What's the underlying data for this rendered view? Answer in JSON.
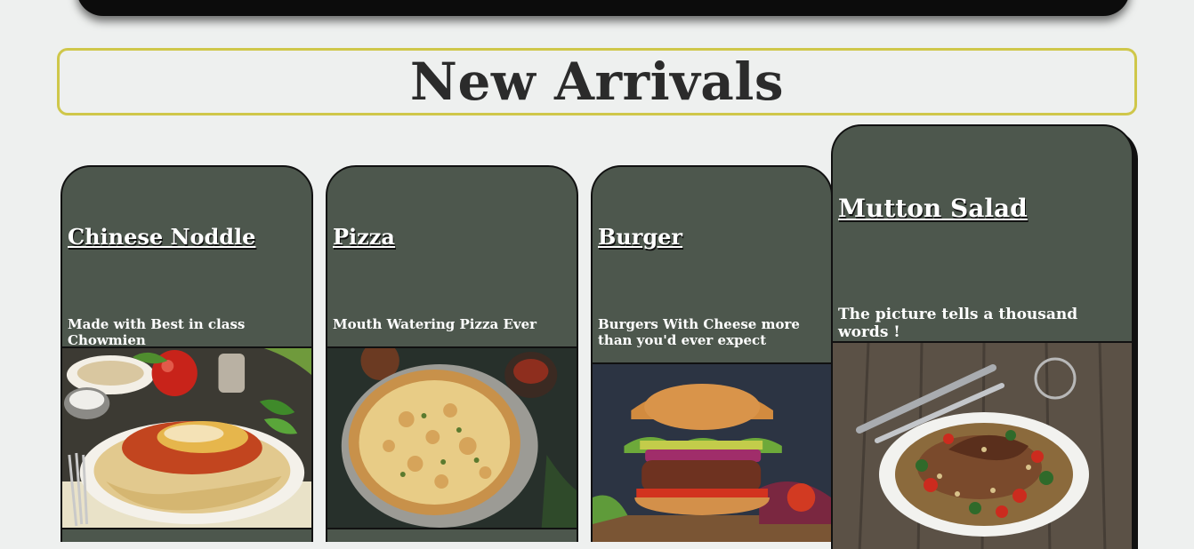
{
  "section": {
    "title": "New Arrivals"
  },
  "cards": [
    {
      "name": "Chinese Noddle",
      "description": "Made with Best in class Chowmien",
      "image": "spaghetti-plate-image"
    },
    {
      "name": "Pizza",
      "description": "Mouth Watering Pizza Ever",
      "image": "pizza-image"
    },
    {
      "name": "Burger",
      "description": "Burgers With Cheese more than you'd ever expect",
      "image": "burger-image"
    },
    {
      "name": "Mutton Salad",
      "description": "The picture tells a thousand words !",
      "image": "mutton-salad-image"
    }
  ],
  "colors": {
    "card_bg": "#4d574d",
    "title_border": "#cfc74a",
    "page_bg": "#eef0ef"
  }
}
